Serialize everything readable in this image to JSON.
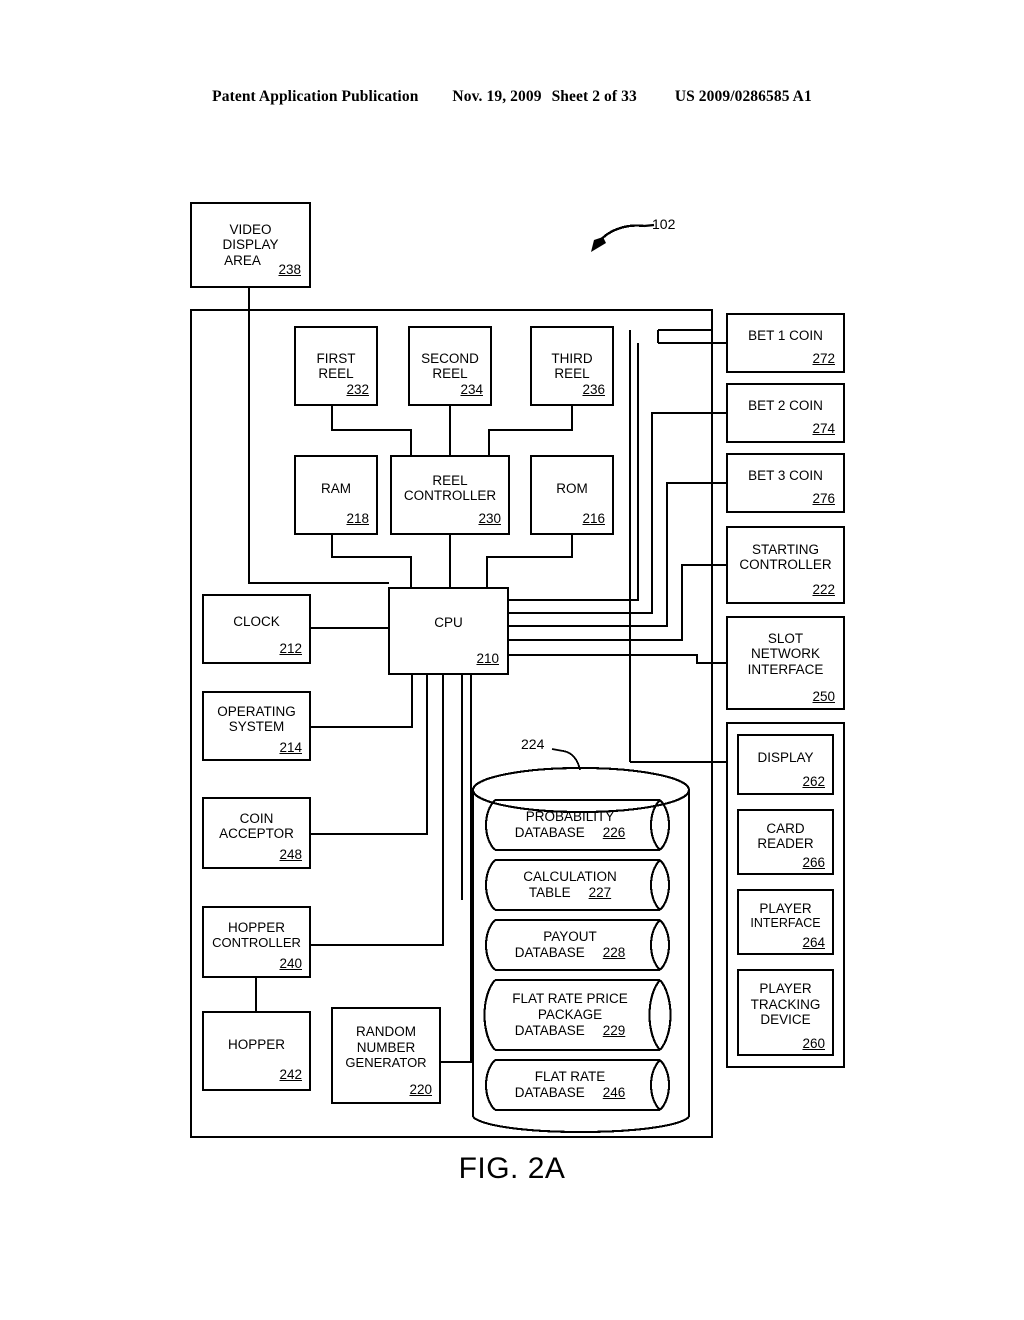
{
  "header": {
    "publication": "Patent Application Publication",
    "date": "Nov. 19, 2009",
    "sheet": "Sheet 2 of 33",
    "docnum": "US 2009/0286585 A1"
  },
  "figure": {
    "caption": "FIG. 2A",
    "system_ref": "102",
    "database_ref": "224"
  },
  "blocks": {
    "video_display": {
      "lines": [
        "VIDEO",
        "DISPLAY",
        "AREA"
      ],
      "ref": "238"
    },
    "first_reel": {
      "lines": [
        "FIRST",
        "REEL"
      ],
      "ref": "232"
    },
    "second_reel": {
      "lines": [
        "SECOND",
        "REEL"
      ],
      "ref": "234"
    },
    "third_reel": {
      "lines": [
        "THIRD",
        "REEL"
      ],
      "ref": "236"
    },
    "ram": {
      "lines": [
        "RAM"
      ],
      "ref": "218"
    },
    "reel_controller": {
      "lines": [
        "REEL",
        "CONTROLLER"
      ],
      "ref": "230"
    },
    "rom": {
      "lines": [
        "ROM"
      ],
      "ref": "216"
    },
    "clock": {
      "lines": [
        "CLOCK"
      ],
      "ref": "212"
    },
    "cpu": {
      "lines": [
        "CPU"
      ],
      "ref": "210"
    },
    "operating_system": {
      "lines": [
        "OPERATING",
        "SYSTEM"
      ],
      "ref": "214"
    },
    "coin_acceptor": {
      "lines": [
        "COIN",
        "ACCEPTOR"
      ],
      "ref": "248"
    },
    "hopper_controller": {
      "lines": [
        "HOPPER",
        "CONTROLLER"
      ],
      "ref": "240"
    },
    "hopper": {
      "lines": [
        "HOPPER"
      ],
      "ref": "242"
    },
    "random_number_generator": {
      "lines": [
        "RANDOM",
        "NUMBER",
        "GENERATOR"
      ],
      "ref": "220"
    },
    "bet_1_coin": {
      "lines": [
        "BET 1 COIN"
      ],
      "ref": "272"
    },
    "bet_2_coin": {
      "lines": [
        "BET 2 COIN"
      ],
      "ref": "274"
    },
    "bet_3_coin": {
      "lines": [
        "BET 3 COIN"
      ],
      "ref": "276"
    },
    "starting_controller": {
      "lines": [
        "STARTING",
        "CONTROLLER"
      ],
      "ref": "222"
    },
    "slot_network_interface": {
      "lines": [
        "SLOT",
        "NETWORK",
        "INTERFACE"
      ],
      "ref": "250"
    },
    "display": {
      "lines": [
        "DISPLAY"
      ],
      "ref": "262"
    },
    "card_reader": {
      "lines": [
        "CARD",
        "READER"
      ],
      "ref": "266"
    },
    "player_interface": {
      "lines": [
        "PLAYER",
        "INTERFACE"
      ],
      "ref": "264"
    },
    "player_tracking_device": {
      "lines": [
        "PLAYER",
        "TRACKING",
        "DEVICE"
      ],
      "ref": "260"
    }
  },
  "databases": {
    "probability": {
      "lines": [
        "PROBABILITY",
        "DATABASE"
      ],
      "ref": "226"
    },
    "calculation_table": {
      "lines": [
        "CALCULATION",
        "TABLE"
      ],
      "ref": "227"
    },
    "payout": {
      "lines": [
        "PAYOUT",
        "DATABASE"
      ],
      "ref": "228"
    },
    "flat_rate_price_package": {
      "lines": [
        "FLAT RATE PRICE",
        "PACKAGE",
        "DATABASE"
      ],
      "ref": "229"
    },
    "flat_rate": {
      "lines": [
        "FLAT RATE",
        "DATABASE"
      ],
      "ref": "246"
    }
  },
  "colors": {
    "ink": "#000000",
    "paper": "#ffffff"
  }
}
